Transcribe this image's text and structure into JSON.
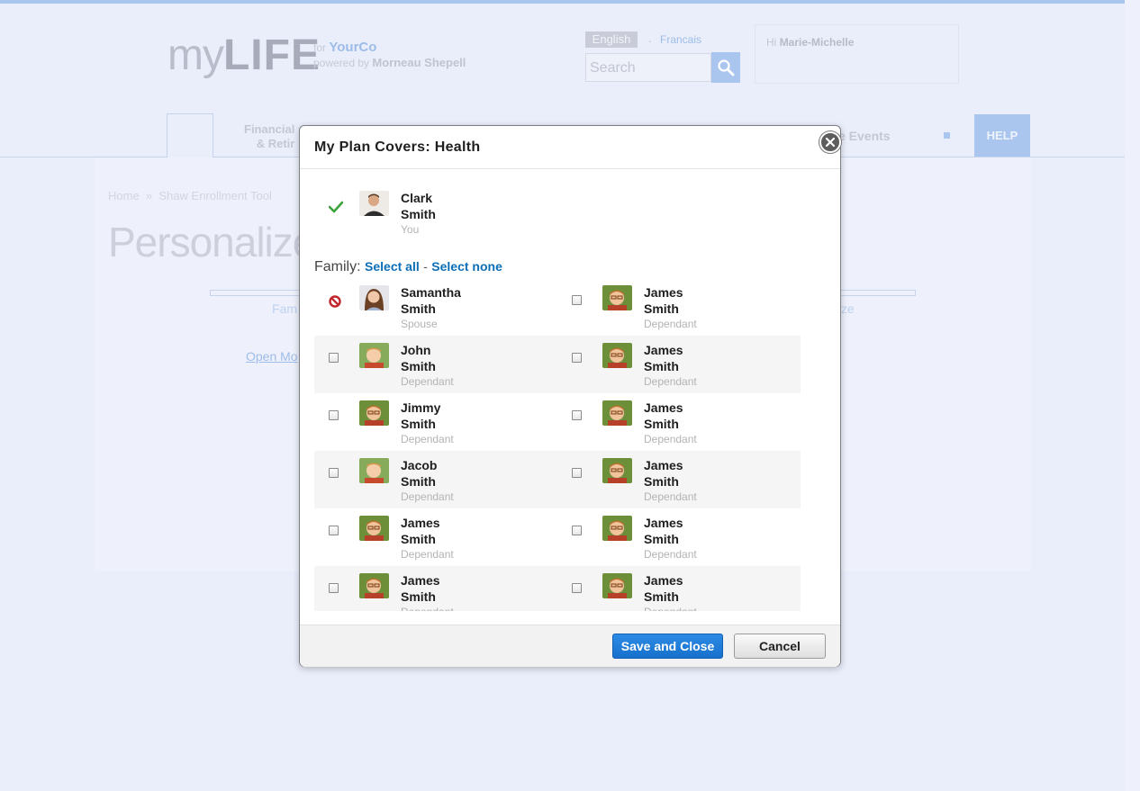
{
  "header": {
    "logo_my": "my",
    "logo_life": "LIFE",
    "for_text": "for",
    "company": "YourCo",
    "powered_text": "powered by",
    "powered_by": "Morneau Shepell",
    "lang_english": "English",
    "lang_sep": ".",
    "lang_french": "Francais",
    "search_placeholder": "Search",
    "greeting_prefix": "Hi",
    "user_name": "Marie-Michelle"
  },
  "nav": {
    "financial_line1": "Financial ",
    "financial_line2": "& Retir",
    "events": "e Events",
    "help": "HELP"
  },
  "page": {
    "breadcrumb_home": "Home",
    "breadcrumb_sep": "»",
    "breadcrumb_tool": "Shaw Enrollment Tool",
    "title": "Personalize Yo",
    "step_left": "Fam",
    "step_right": "ze",
    "open_modal_link": "Open Mo"
  },
  "modal": {
    "title": "My Plan Covers: Health",
    "self": {
      "first": "Clark",
      "last": "Smith",
      "role": "You"
    },
    "family_label": "Family:",
    "select_all": "Select all",
    "select_sep": "-",
    "select_none": "Select none",
    "family": [
      {
        "first": "Samantha",
        "last": "Smith",
        "role": "Spouse"
      },
      {
        "first": "James",
        "last": "Smith",
        "role": "Dependant"
      },
      {
        "first": "John",
        "last": "Smith",
        "role": "Dependant"
      },
      {
        "first": "James",
        "last": "Smith",
        "role": "Dependant"
      },
      {
        "first": "Jimmy",
        "last": "Smith",
        "role": "Dependant"
      },
      {
        "first": "James",
        "last": "Smith",
        "role": "Dependant"
      },
      {
        "first": "Jacob",
        "last": "Smith",
        "role": "Dependant"
      },
      {
        "first": "James",
        "last": "Smith",
        "role": "Dependant"
      },
      {
        "first": "James",
        "last": "Smith",
        "role": "Dependant"
      },
      {
        "first": "James",
        "last": "Smith",
        "role": "Dependant"
      },
      {
        "first": "James",
        "last": "Smith",
        "role": "Dependant"
      },
      {
        "first": "James",
        "last": "Smith",
        "role": "Dependant"
      }
    ],
    "save_label": "Save and Close",
    "cancel_label": "Cancel"
  },
  "colors": {
    "accent": "#1670cc",
    "link": "#0b6fb8",
    "check_green": "#3aa33a",
    "block_red": "#c0262c"
  }
}
